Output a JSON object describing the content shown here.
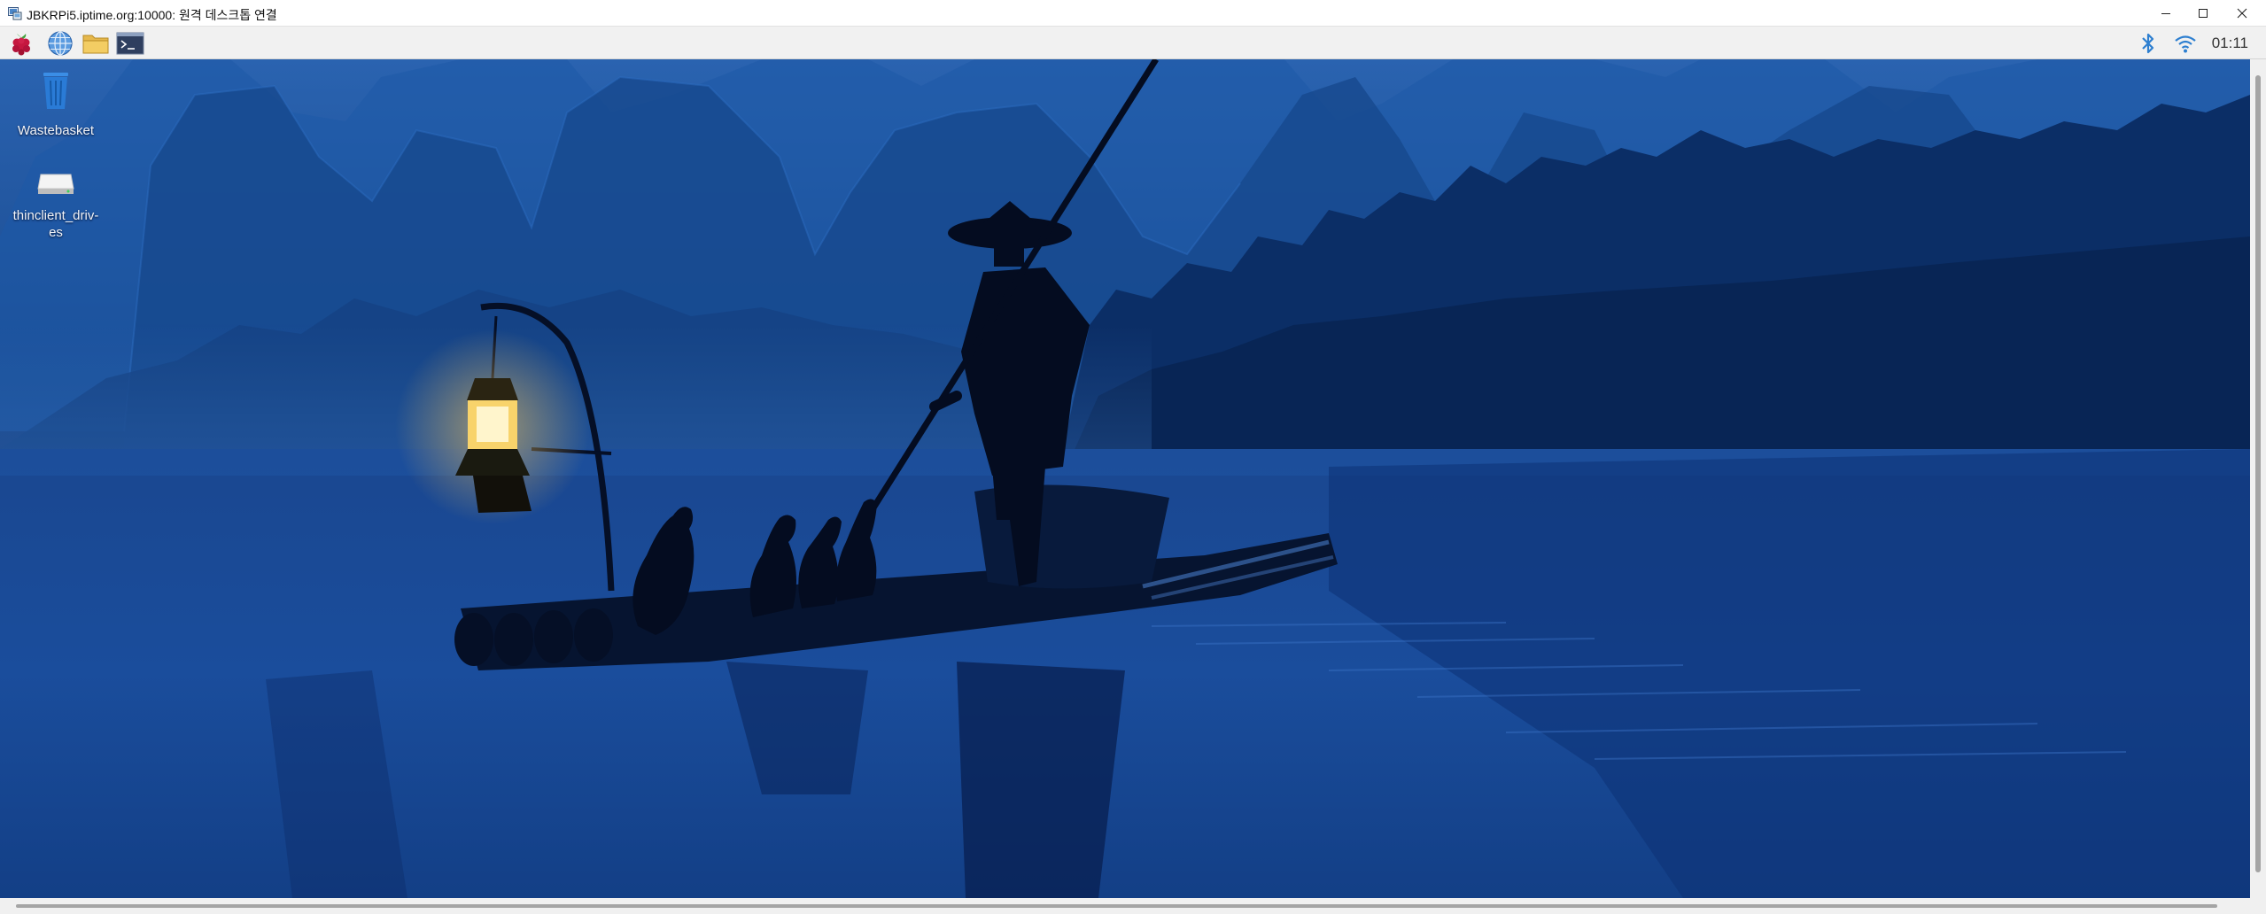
{
  "window": {
    "title": "JBKRPi5.iptime.org:10000: 원격 데스크톱 연결",
    "controls": [
      "minimize-icon",
      "maximize-icon",
      "close-icon"
    ]
  },
  "panel": {
    "launchers": [
      {
        "name": "raspberry-menu-icon"
      },
      {
        "name": "web-browser-icon"
      },
      {
        "name": "file-manager-icon"
      },
      {
        "name": "terminal-icon"
      }
    ],
    "tray": {
      "bluetooth_icon": "bluetooth-icon",
      "wifi_icon": "wifi-icon",
      "clock": "01:11",
      "accent_color": "#2d7fd0"
    }
  },
  "desktop": {
    "icons": [
      {
        "label": "Wastebasket",
        "icon": "trash-icon"
      },
      {
        "label": "thinclient_driv-\nes",
        "icon": "drive-icon"
      }
    ],
    "wallpaper": "fisherman-on-bamboo-raft-at-dusk"
  }
}
